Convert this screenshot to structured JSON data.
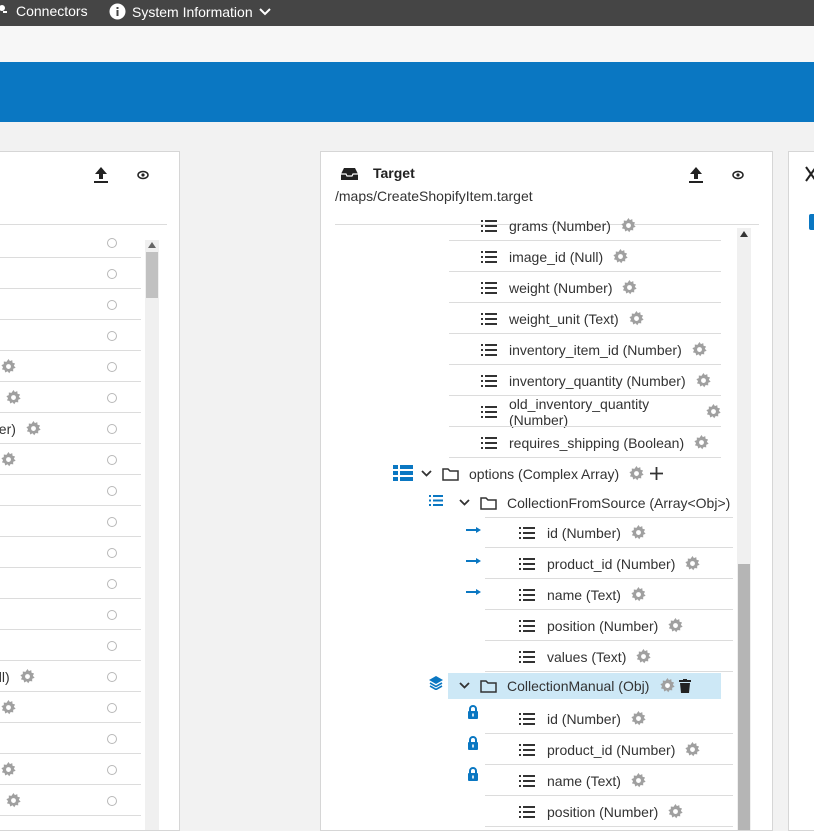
{
  "topbar": {
    "connectors_label": "Connectors",
    "sysinfo_label": "System Information"
  },
  "target_panel": {
    "title": "Target",
    "path": "/maps/CreateShopifyItem.target",
    "fields_top": [
      {
        "label": "grams (Number)"
      },
      {
        "label": "image_id (Null)"
      },
      {
        "label": "weight (Number)"
      },
      {
        "label": "weight_unit (Text)"
      },
      {
        "label": "inventory_item_id (Number)"
      },
      {
        "label": "inventory_quantity (Number)"
      },
      {
        "label": "old_inventory_quantity (Number)"
      },
      {
        "label": "requires_shipping (Boolean)"
      }
    ],
    "options_label": "options (Complex Array)",
    "collection_from_source_label": "CollectionFromSource (Array<Obj>)",
    "cfs_fields": [
      {
        "label": "id (Number)",
        "mapped": true
      },
      {
        "label": "product_id (Number)",
        "mapped": true
      },
      {
        "label": "name (Text)",
        "mapped": true
      },
      {
        "label": "position (Number)",
        "mapped": false
      },
      {
        "label": "values (Text)",
        "mapped": false
      }
    ],
    "collection_manual_label": "CollectionManual (Obj)",
    "cm_fields": [
      {
        "label": "id (Number)",
        "locked": true
      },
      {
        "label": "product_id (Number)",
        "locked": true
      },
      {
        "label": "name (Text)",
        "locked": true
      },
      {
        "label": "position (Number)",
        "locked": false
      }
    ]
  },
  "source_panel": {
    "partial_labels": [
      "",
      "",
      "",
      "",
      "",
      ")",
      "ber)",
      "",
      "",
      "",
      "",
      "",
      "",
      "",
      "ull)",
      "",
      "",
      "",
      ")"
    ]
  }
}
